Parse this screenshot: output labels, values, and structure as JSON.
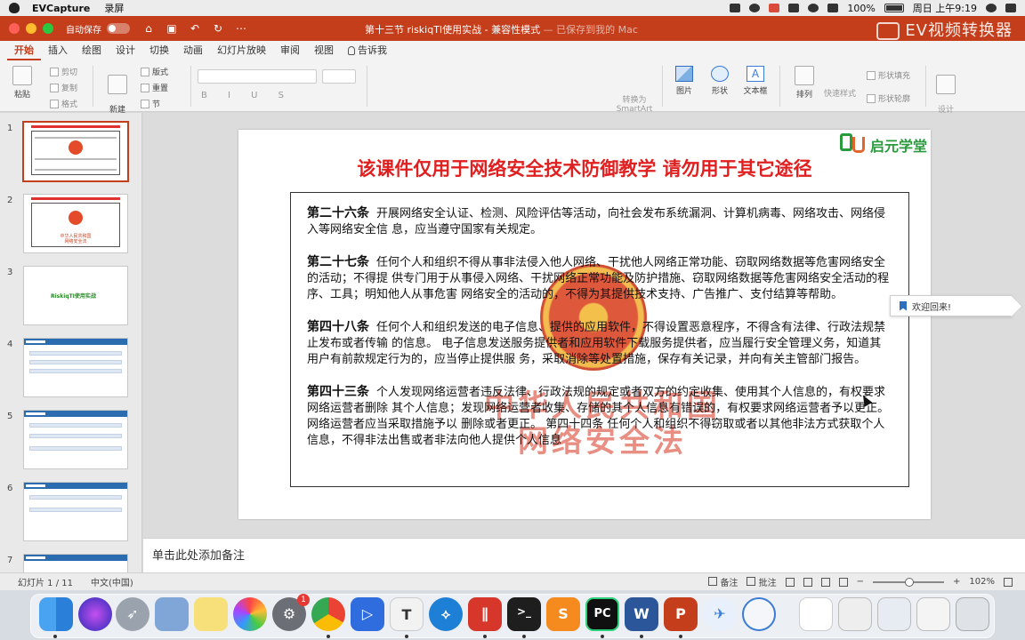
{
  "menubar": {
    "app_name": "EVCapture",
    "menu": "录屏",
    "battery": "100%",
    "clock": "周日 上午9:19"
  },
  "titlebar": {
    "autosave": "自动保存",
    "doc_title": "第十三节 riskiqTI使用实战 - 兼容性模式",
    "saved_status": " — 已保存到我的 Mac",
    "watermark": "EV视频转换器"
  },
  "tabs": [
    "开始",
    "插入",
    "绘图",
    "设计",
    "切换",
    "动画",
    "幻灯片放映",
    "审阅",
    "视图",
    "告诉我"
  ],
  "ribbon": {
    "paste": "粘贴",
    "cut": "剪切",
    "copy": "复制",
    "format": "格式",
    "new_slide": "新建\n幻灯片",
    "layout": "版式",
    "reset": "重置",
    "section": "节",
    "convert_smartart": "转换为\nSmartArt",
    "picture": "图片",
    "shape": "形状",
    "textbox": "文本框",
    "arrange": "排列",
    "quick_styles": "快速样式",
    "shape_fill": "形状填充",
    "shape_outline": "形状轮廓",
    "design_ideas": "设计\n灵感"
  },
  "thumbnails": {
    "numbers": [
      "1",
      "2",
      "3",
      "4",
      "5",
      "6",
      "7"
    ],
    "slide3_title": "RiskiqTI使用实战",
    "slide2_caption": "中华人民共和国\n网络安全法"
  },
  "slide": {
    "brand_name": "启元学堂",
    "title": "该课件仅用于网络安全技术防御教学   请勿用于其它途径",
    "background_text": "中华人民共和国\n网络安全法",
    "paragraphs": [
      {
        "heading": "第二十六条",
        "text": "开展网络安全认证、检测、风险评估等活动，向社会发布系统漏洞、计算机病毒、网络攻击、网络侵入等网络安全信 息，应当遵守国家有关规定。"
      },
      {
        "heading": "第二十七条",
        "text": "任何个人和组织不得从事非法侵入他人网络、干扰他人网络正常功能、窃取网络数据等危害网络安全的活动；不得提 供专门用于从事侵入网络、干扰网络正常功能及防护措施、窃取网络数据等危害网络安全活动的程序、工具；明知他人从事危害 网络安全的活动的，不得为其提供技术支持、广告推广、支付结算等帮助。"
      },
      {
        "heading": "第四十八条",
        "text": "任何个人和组织发送的电子信息、提供的应用软件，不得设置恶意程序，不得含有法律、行政法规禁止发布或者传输 的信息。 电子信息发送服务提供者和应用软件下载服务提供者，应当履行安全管理义务，知道其用户有前款规定行为的，应当停止提供服 务，采取消除等处置措施，保存有关记录，并向有关主管部门报告。"
      },
      {
        "heading": "第四十三条",
        "text": "个人发现网络运营者违反法律、行政法规的规定或者双方的约定收集、使用其个人信息的，有权要求网络运营者删除 其个人信息；发现网络运营者收集、存储的其个人信息有错误的，有权要求网络运营者予以更正。网络运营者应当采取措施予以 删除或者更正。 第四十四条  任何个人和组织不得窃取或者以其他非法方式获取个人信息，不得非法出售或者非法向他人提供个人信息"
      }
    ]
  },
  "welcome_tip": "欢迎回来!",
  "notes_placeholder": "单击此处添加备注",
  "status": {
    "slide_info": "幻灯片 1 / 11",
    "language": "中文(中国)",
    "notes": "备注",
    "comments": "批注",
    "zoom": "102%"
  },
  "dock": {
    "badge": "1",
    "apps": [
      "finder-icon",
      "siri-icon",
      "launchpad-icon",
      "preview-icon",
      "notes-icon",
      "photos-icon",
      "system-preferences-icon",
      "chrome-icon",
      "baidu-netdisk-icon",
      "typora-icon",
      "network-icon",
      "parallels-icon",
      "terminal-icon",
      "sublime-text-icon",
      "pycharm-icon",
      "word-icon",
      "powerpoint-icon",
      "bird-icon",
      "safari-icon",
      "document-icon",
      "screenshot-icon",
      "screenshot2-icon",
      "trash-icon"
    ]
  }
}
